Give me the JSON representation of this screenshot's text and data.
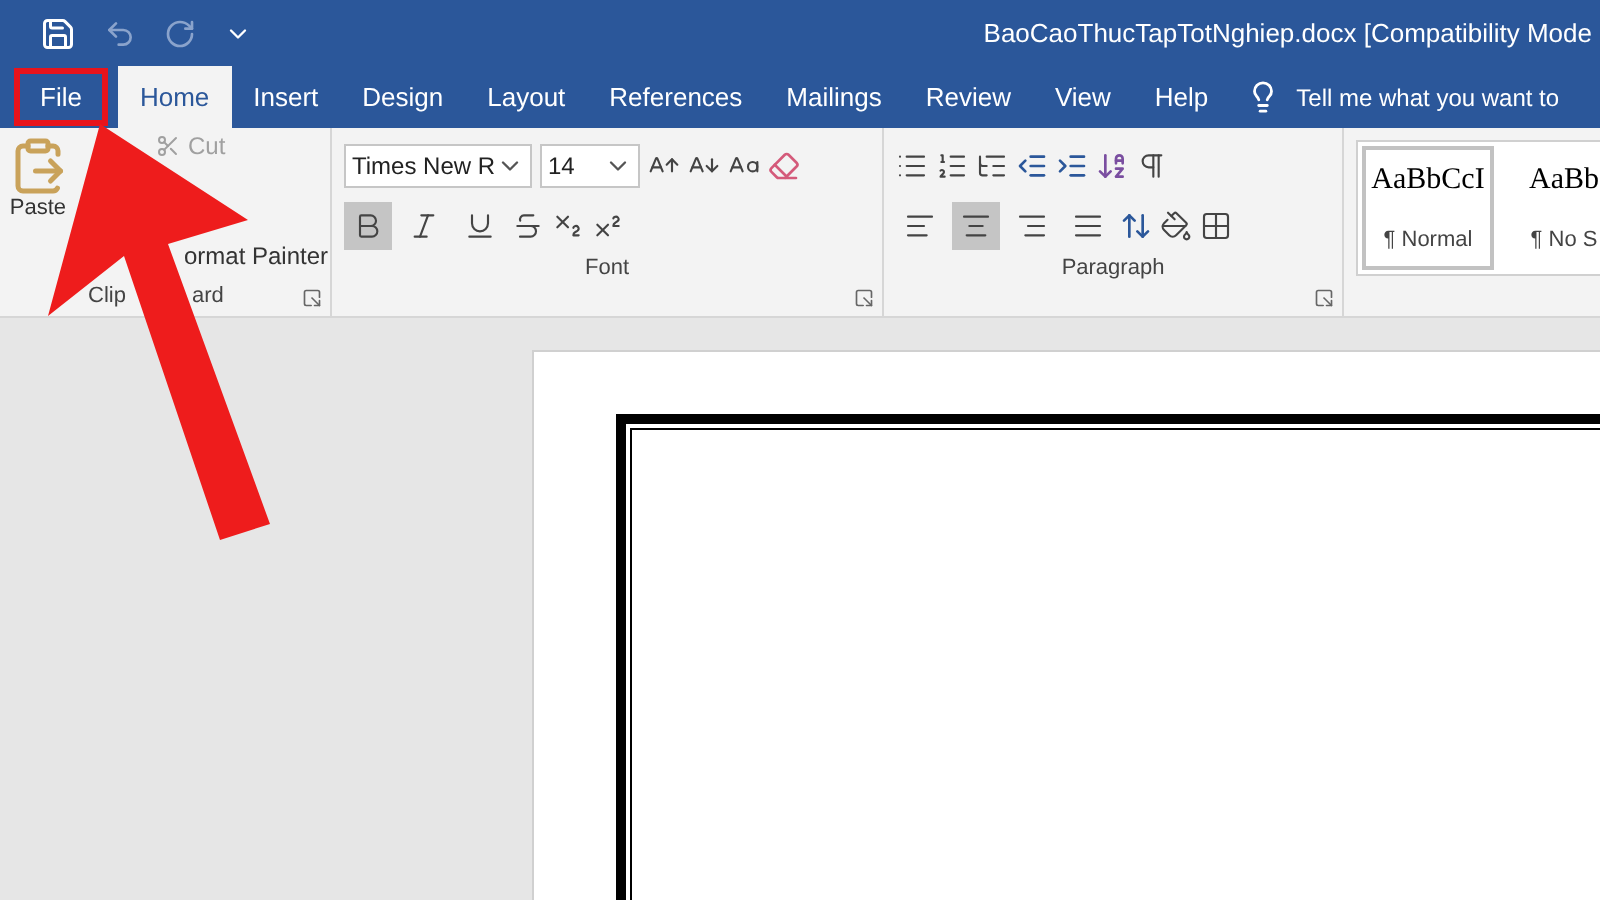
{
  "window": {
    "title": "BaoCaoThucTapTotNghiep.docx [Compatibility Mode"
  },
  "tabs": [
    {
      "label": "File",
      "selected": false,
      "kind": "file"
    },
    {
      "label": "Home",
      "selected": true,
      "kind": "tab"
    },
    {
      "label": "Insert",
      "selected": false,
      "kind": "tab"
    },
    {
      "label": "Design",
      "selected": false,
      "kind": "tab"
    },
    {
      "label": "Layout",
      "selected": false,
      "kind": "tab"
    },
    {
      "label": "References",
      "selected": false,
      "kind": "tab"
    },
    {
      "label": "Mailings",
      "selected": false,
      "kind": "tab"
    },
    {
      "label": "Review",
      "selected": false,
      "kind": "tab"
    },
    {
      "label": "View",
      "selected": false,
      "kind": "tab"
    },
    {
      "label": "Help",
      "selected": false,
      "kind": "tab"
    }
  ],
  "tell_me": "Tell me what you want to",
  "clipboard": {
    "paste": "Paste",
    "cut": "Cut",
    "format_painter": "ormat Painter",
    "label_parts": [
      "Clip",
      "ard"
    ]
  },
  "font": {
    "name": "Times New R",
    "size": "14",
    "label": "Font",
    "bold": true,
    "italic": false,
    "underline": false
  },
  "paragraph": {
    "label": "Paragraph",
    "align": [
      {
        "kind": "left",
        "selected": false
      },
      {
        "kind": "center",
        "selected": true
      },
      {
        "kind": "right",
        "selected": false
      },
      {
        "kind": "justify",
        "selected": false
      }
    ]
  },
  "styles": [
    {
      "sample": "AaBbCcI",
      "name": "¶ Normal",
      "selected": true
    },
    {
      "sample": "AaBb",
      "name": "¶ No S",
      "selected": false
    }
  ]
}
